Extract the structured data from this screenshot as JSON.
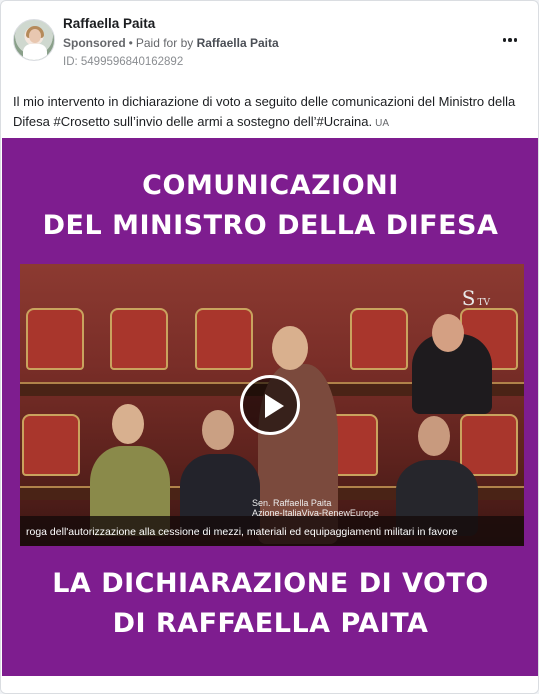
{
  "post": {
    "page_name": "Raffaella Paita",
    "sponsored": "Sponsored",
    "separator": "•",
    "paid_for_prefix": "Paid for by",
    "payer": "Raffaella Paita",
    "ad_id": "ID: 5499596840162892",
    "more_icon": "more-dots-icon",
    "text": "Il mio intervento in dichiarazione di voto a seguito delle comunicazioni del Ministro della Difesa #Crosetto sull’invio delle armi a sostegno dell’#Ucraina.",
    "language_tag": "UA"
  },
  "media": {
    "background_color": "#7e1d8f",
    "headline_top_line1": "COMUNICAZIONI",
    "headline_top_line2": "DEL MINISTRO DELLA DIFESA",
    "headline_bottom_line1": "LA DICHIARAZIONE DI VOTO",
    "headline_bottom_line2": "DI RAFFAELLA PAITA",
    "video": {
      "channel_logo": "S",
      "channel_suffix": "TV",
      "speaker_caption_line1": "Sen. Raffaella Paita",
      "speaker_caption_line2": "Azione-ItaliaViva-RenewEurope",
      "subtitle": "roga dell'autorizzazione alla cessione di mezzi, materiali ed equipaggiamenti militari in favore",
      "play_icon": "play-icon"
    }
  }
}
